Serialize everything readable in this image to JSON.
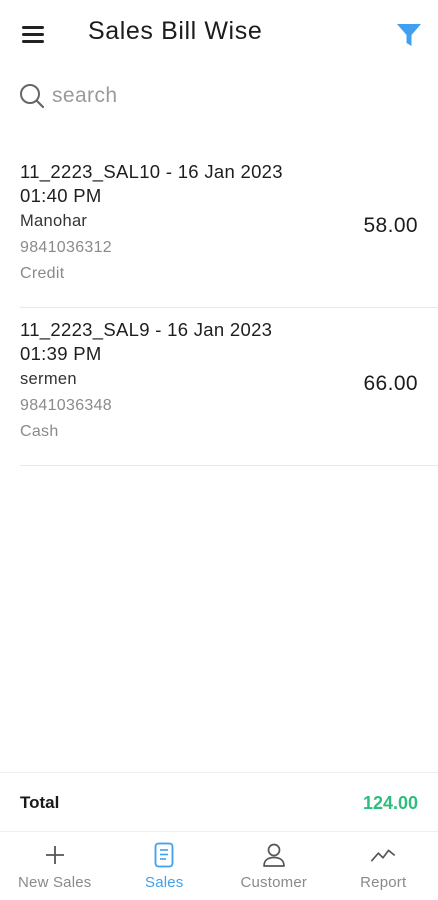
{
  "header": {
    "title": "Sales Bill Wise"
  },
  "search": {
    "placeholder": "search",
    "value": ""
  },
  "bills": [
    {
      "id_date": "11_2223_SAL10 - 16 Jan 2023 01:40 PM",
      "customer": "Manohar",
      "phone": "9841036312",
      "payment_mode": "Credit",
      "amount": "58.00"
    },
    {
      "id_date": "11_2223_SAL9 - 16 Jan 2023 01:39 PM",
      "customer": "sermen",
      "phone": "9841036348",
      "payment_mode": "Cash",
      "amount": "66.00"
    }
  ],
  "total": {
    "label": "Total",
    "value": "124.00"
  },
  "nav": {
    "items": [
      {
        "label": "New Sales",
        "icon": "plus-icon"
      },
      {
        "label": "Sales",
        "icon": "receipt-icon",
        "active": true
      },
      {
        "label": "Customer",
        "icon": "person-icon"
      },
      {
        "label": "Report",
        "icon": "trend-icon"
      }
    ]
  },
  "colors": {
    "accent": "#3fa0ef",
    "total_value": "#2ebd7d",
    "muted_text": "#8a8a8a"
  }
}
